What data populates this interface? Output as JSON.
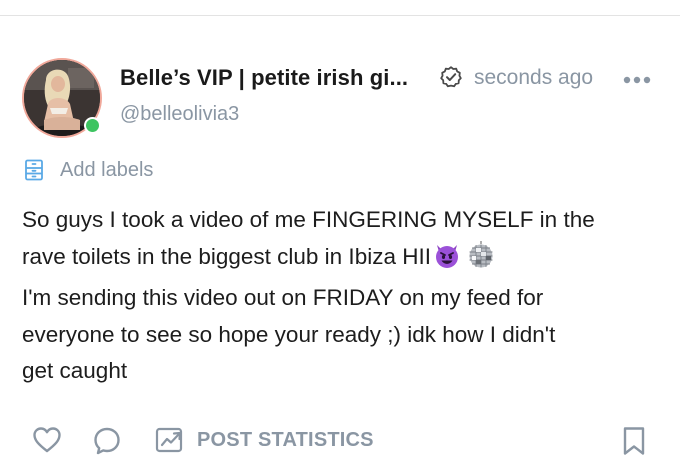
{
  "post": {
    "author": {
      "display_name": "Belle’s VIP | petite irish gi...",
      "username": "@belleolivia3",
      "verified": true,
      "online": true,
      "online_color": "#3ec461",
      "avatar_ring_color": "#f0a89a"
    },
    "timestamp": "seconds ago",
    "labels_button": "Add labels",
    "text_lines": [
      "So guys I took a video of me FINGERING MYSELF in the",
      "rave toilets in the biggest club in Ibiza HII",
      "I'm sending this video out on FRIDAY on my feed for",
      "everyone to see so hope your ready ;) idk how I didn't",
      "get caught"
    ],
    "emojis_line2": [
      "smiling-devil-emoji",
      "disco-ball-emoji"
    ],
    "actions": {
      "stats_label": "POST STATISTICS"
    }
  },
  "colors": {
    "muted": "#8a96a3",
    "text": "#1d1d1d",
    "divider": "#e3e3e3"
  },
  "icons": {
    "verified": "verified-badge-icon",
    "more": "more-dots-icon",
    "labels": "label-tag-icon",
    "like": "heart-icon",
    "comment": "comment-bubble-icon",
    "stats": "statistics-chart-icon",
    "bookmark": "bookmark-icon"
  }
}
